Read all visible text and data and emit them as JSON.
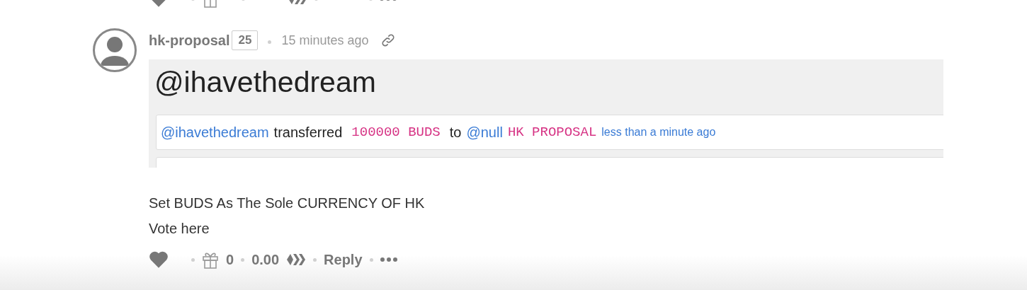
{
  "comment": {
    "author": "hk-proposal",
    "reputation": "25",
    "time": "15 minutes ago",
    "embed": {
      "kind": "picture_of_page",
      "heading": "@ihavethedream",
      "transfer": {
        "from": "@ihavethedream",
        "verb": "transferred",
        "amount": "100000 BUDS",
        "preposition": "to",
        "to": "@null",
        "memo": "HK PROPOSAL",
        "time": "less than a minute ago"
      }
    },
    "body": [
      "Set BUDS As The Sole CURRENCY OF HK",
      "Vote here"
    ],
    "actions": {
      "gift_count": "0",
      "payout": "0.00",
      "reply": "Reply"
    }
  }
}
